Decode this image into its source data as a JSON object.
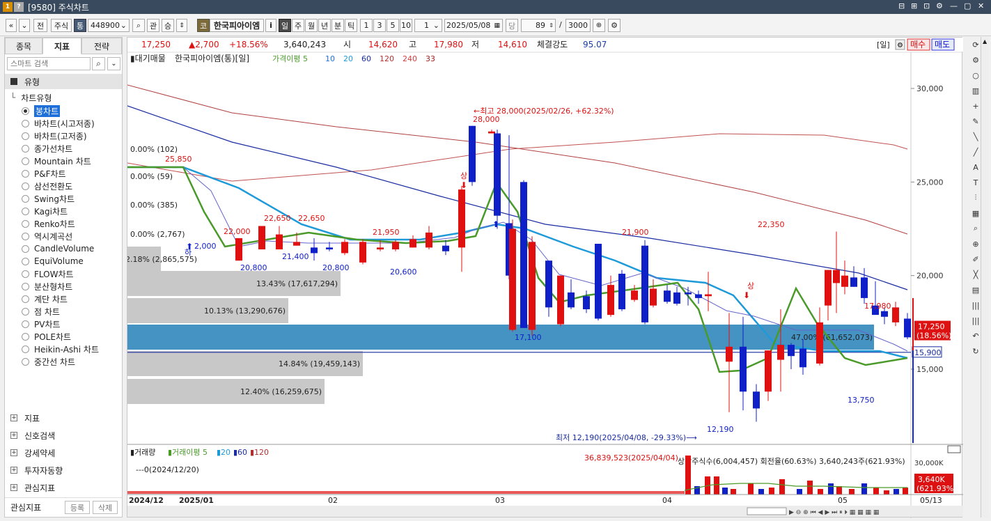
{
  "window": {
    "title": "[9580] 주식차트",
    "badge": "1 ?",
    "controls": [
      "⊟",
      "⊞",
      "⊡",
      "⚙",
      "—",
      "▢",
      "✕"
    ]
  },
  "toolbar": {
    "nav_prev": "«",
    "nav_down": "»",
    "prev_label": "전",
    "stock_label": "주식",
    "type_label": "통",
    "code_value": "448900",
    "search_icon": "🔍",
    "gwan": "관",
    "seung": "승",
    "market_badge": "코",
    "stock_name": "한국피아이엠",
    "info": "i",
    "periods": [
      "일",
      "주",
      "월",
      "년",
      "분",
      "틱"
    ],
    "intervals": [
      "1",
      "3",
      "5",
      "10"
    ],
    "count_value": "1",
    "date_value": "2025/05/08",
    "dang": "당",
    "zoom_value": "89",
    "total_value": "3000"
  },
  "left_panel": {
    "tabs": [
      "종목",
      "지표",
      "전략"
    ],
    "search_placeholder": "스마트 검색",
    "header": "유형",
    "group": "차트유형",
    "items": [
      "봉차트",
      "바차트(시고저종)",
      "바차트(고저종)",
      "종가선차트",
      "Mountain 차트",
      "P&F차트",
      "삼선전환도",
      "Swing차트",
      "Kagi차트",
      "Renko차트",
      "역시계곡선",
      "CandleVolume",
      "EquiVolume",
      "FLOW차트",
      "분산형차트",
      "계단 차트",
      "점 차트",
      "PV차트",
      "POLE차트",
      "Heikin-Ashi 차트",
      "중간선 차트"
    ],
    "sections": [
      "지표",
      "신호검색",
      "강세약세",
      "투자자동향",
      "관심지표"
    ],
    "footer": {
      "label": "관심지표",
      "add": "등록",
      "remove": "삭제"
    }
  },
  "price_bar": {
    "current": "17,250",
    "change": "▲2,700",
    "change_pct": "+18.56%",
    "volume": "3,640,243",
    "open_label": "시",
    "open": "14,620",
    "high_label": "고",
    "high": "17,980",
    "low_label": "저",
    "low": "14,610",
    "strength_label": "체결강도",
    "strength": "95.07",
    "day_btn": "[일]",
    "buy_btn": "매수",
    "sell_btn": "매도"
  },
  "legend": {
    "main": "대기매물",
    "name": "한국피아이엠(통)[일]",
    "ma_label": "가격이평 5",
    "ma_items": [
      {
        "t": "10",
        "c": "#1e6fd9"
      },
      {
        "t": "20",
        "c": "#1e9ad9"
      },
      {
        "t": "60",
        "c": "#1a2ca0"
      },
      {
        "t": "120",
        "c": "#b03030"
      },
      {
        "t": "240",
        "c": "#d04040"
      },
      {
        "t": "33",
        "c": "#a02020"
      }
    ]
  },
  "chart_data": {
    "type": "candlestick",
    "y_ticks": [
      "30,000",
      "25,000",
      "20,000",
      "15,000"
    ],
    "x_ticks": [
      "2024/12",
      "2025/01",
      "02",
      "03",
      "04",
      "05",
      "05/13"
    ],
    "annotations": {
      "high": "←최고 28,000(2025/02/26, +62.32%)",
      "low": "최저 12,190(2025/04/08, -29.33%)⟶",
      "labels": [
        "28,000",
        "25,850",
        "22,000",
        "22,650",
        "22,650",
        "21,950",
        "21,900",
        "22,350",
        "17,980",
        "20,800",
        "21,400",
        "20,800",
        "20,600",
        "17,100",
        "12,190",
        "13,750",
        "2,000",
        "상",
        "상",
        "하"
      ]
    },
    "volume_profile": [
      {
        "label": "0.00% (102)",
        "w": 0
      },
      {
        "label": "0.00% (59)",
        "w": 0
      },
      {
        "label": "0.00% (385)",
        "w": 0
      },
      {
        "label": "0.00% (2,767)",
        "w": 0
      },
      {
        "label": "2.18% (2,865,575)",
        "w": 48
      },
      {
        "label": "13.43% (17,617,294)",
        "w": 306
      },
      {
        "label": "10.13% (13,290,676)",
        "w": 231
      },
      {
        "label": "47.00% (61,652,073)",
        "w": 1072
      },
      {
        "label": "14.84% (19,459,143)",
        "w": 338
      },
      {
        "label": "12.40% (16,259,675)",
        "w": 283
      }
    ],
    "price_tag": {
      "value": "17,250",
      "pct": "(18.56%)"
    },
    "line_tag": "15,900",
    "volume": {
      "legend": "거래량",
      "ma": "거래이평 5",
      "ma_items": [
        "20",
        "60",
        "120"
      ],
      "note_max": "36,839,523(2025/04/04)",
      "note_zero": "0(2024/12/20)",
      "note_info": "상장주식수(6,004,457) 회전율(60.63%) 3,640,243주(621.93%)",
      "y_tick": "30,000K",
      "tag_value": "3,640K",
      "tag_pct": "(621.93%)"
    }
  }
}
